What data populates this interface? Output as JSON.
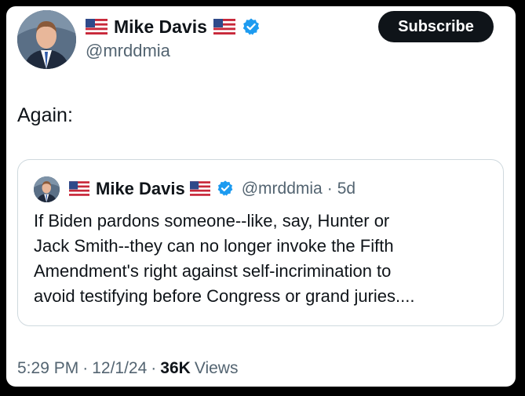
{
  "author": {
    "display_name": "Mike Davis",
    "handle": "@mrddmia",
    "flag_icon": "us-flag-icon",
    "verified_icon": "verified-badge-icon",
    "verified_color": "#1d9bf0"
  },
  "subscribe_label": "Subscribe",
  "tweet": {
    "text": "Again:"
  },
  "quote": {
    "display_name": "Mike Davis",
    "handle": "@mrddmia",
    "separator": "·",
    "time": "5d",
    "lines": [
      "If Biden pardons someone--like, say, Hunter or",
      "Jack Smith--they can no longer invoke the Fifth",
      "Amendment's right against self-incrimination to",
      "avoid testifying before Congress or grand juries...."
    ]
  },
  "meta": {
    "time": "5:29 PM",
    "separator1": "·",
    "date": "12/1/24",
    "separator2": "·",
    "views_count": "36K",
    "views_label": "Views"
  },
  "colors": {
    "text_primary": "#0f1419",
    "text_secondary": "#536471",
    "border": "#cfd9de",
    "button_bg": "#0f1419"
  }
}
